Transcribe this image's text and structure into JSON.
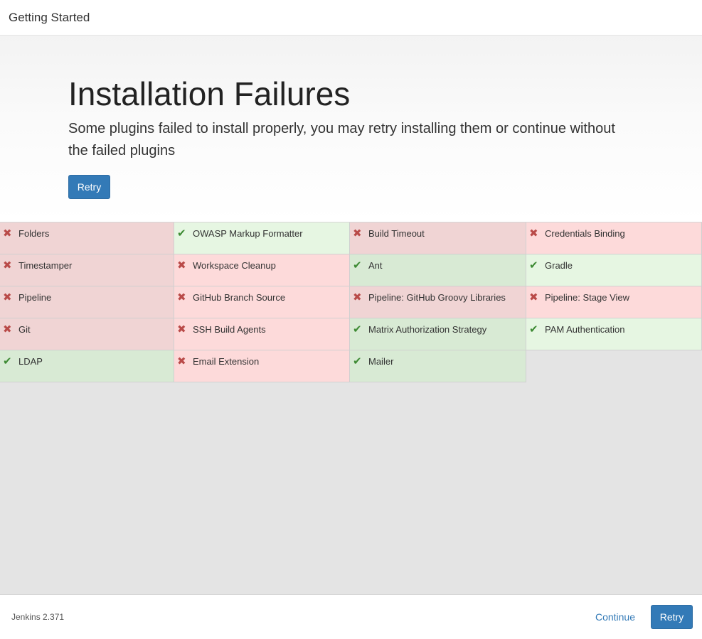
{
  "topbar": {
    "title": "Getting Started"
  },
  "hero": {
    "heading": "Installation Failures",
    "description": "Some plugins failed to install properly, you may retry installing them or continue without the failed plugins",
    "retry_label": "Retry"
  },
  "plugins": [
    [
      {
        "label": "Folders",
        "status": "failed",
        "icon": "x-icon"
      },
      {
        "label": "Timestamper",
        "status": "failed",
        "icon": "x-icon"
      },
      {
        "label": "Pipeline",
        "status": "failed",
        "icon": "x-icon"
      },
      {
        "label": "Git",
        "status": "failed",
        "icon": "x-icon"
      },
      {
        "label": "LDAP",
        "status": "success",
        "icon": "check-icon"
      }
    ],
    [
      {
        "label": "OWASP Markup Formatter",
        "status": "success",
        "icon": "check-icon"
      },
      {
        "label": "Workspace Cleanup",
        "status": "failed",
        "icon": "x-icon"
      },
      {
        "label": "GitHub Branch Source",
        "status": "failed",
        "icon": "x-icon"
      },
      {
        "label": "SSH Build Agents",
        "status": "failed",
        "icon": "x-icon"
      },
      {
        "label": "Email Extension",
        "status": "failed",
        "icon": "x-icon"
      }
    ],
    [
      {
        "label": "Build Timeout",
        "status": "failed",
        "icon": "x-icon"
      },
      {
        "label": "Ant",
        "status": "success",
        "icon": "check-icon"
      },
      {
        "label": "Pipeline: GitHub Groovy Libraries",
        "status": "failed",
        "icon": "x-icon"
      },
      {
        "label": "Matrix Authorization Strategy",
        "status": "success",
        "icon": "check-icon"
      },
      {
        "label": "Mailer",
        "status": "success",
        "icon": "check-icon"
      }
    ],
    [
      {
        "label": "Credentials Binding",
        "status": "failed",
        "icon": "x-icon"
      },
      {
        "label": "Gradle",
        "status": "success",
        "icon": "check-icon"
      },
      {
        "label": "Pipeline: Stage View",
        "status": "failed",
        "icon": "x-icon"
      },
      {
        "label": "PAM Authentication",
        "status": "success",
        "icon": "check-icon"
      }
    ]
  ],
  "footer": {
    "version": "Jenkins 2.371",
    "continue_label": "Continue",
    "retry_label": "Retry"
  },
  "colors": {
    "primary": "#337ab7",
    "failed_bg": "#fddada",
    "success_bg": "#e6f6e2",
    "failed_icon": "#b94a48",
    "success_icon": "#3d8a33"
  }
}
